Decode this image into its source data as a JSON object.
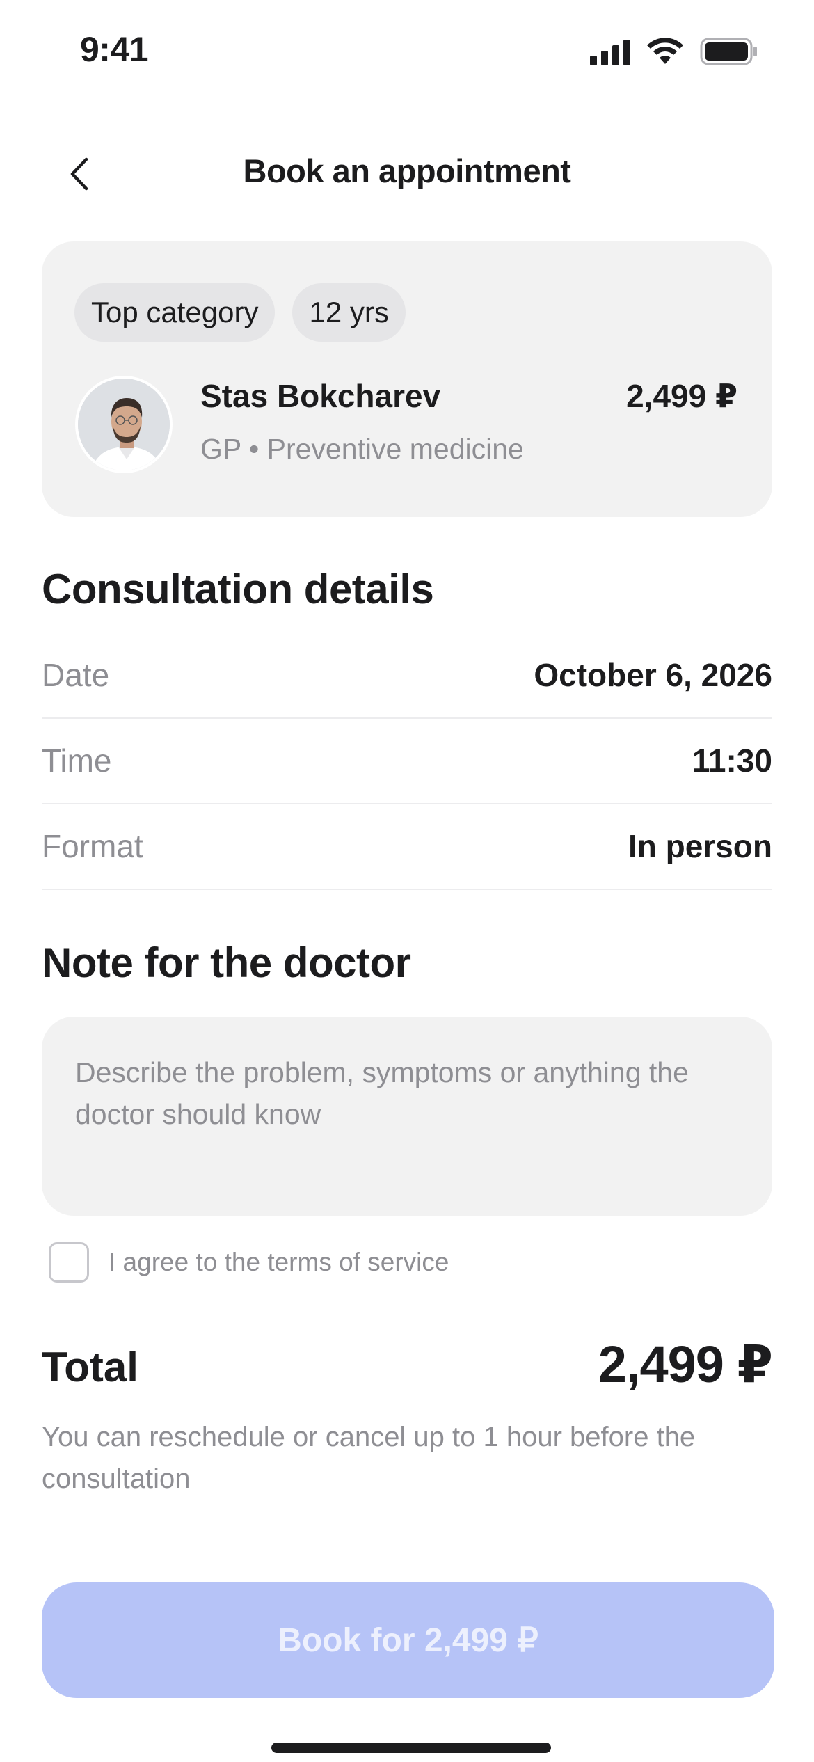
{
  "status_bar": {
    "time": "9:41",
    "icons": [
      "cellular-signal-icon",
      "wifi-icon",
      "battery-icon"
    ]
  },
  "header": {
    "title": "Book an appointment",
    "back_icon": "chevron-left-icon"
  },
  "doctor": {
    "tags": [
      "Top category",
      "12 yrs"
    ],
    "name": "Stas Bokcharev",
    "specialty": "GP • Preventive medicine",
    "price": "2,499 ₽"
  },
  "consultation": {
    "title": "Consultation details",
    "rows": [
      {
        "label": "Date",
        "value": "October 6, 2026"
      },
      {
        "label": "Time",
        "value": "11:30"
      },
      {
        "label": "Format",
        "value": "In person"
      }
    ]
  },
  "note": {
    "title": "Note for the doctor",
    "placeholder": "Describe the problem, symptoms or anything the doctor should know",
    "value": ""
  },
  "terms": {
    "label": "I agree to the terms of service",
    "checked": false
  },
  "total": {
    "label": "Total",
    "value": "2,499 ₽",
    "note": "You can reschedule or cancel up to 1 hour before the consultation"
  },
  "cta": {
    "label": "Book for 2,499 ₽",
    "enabled": false
  },
  "colors": {
    "accent_disabled": "#b6c3f7",
    "card_background": "#f2f2f2",
    "secondary_text": "#8e8e93"
  }
}
